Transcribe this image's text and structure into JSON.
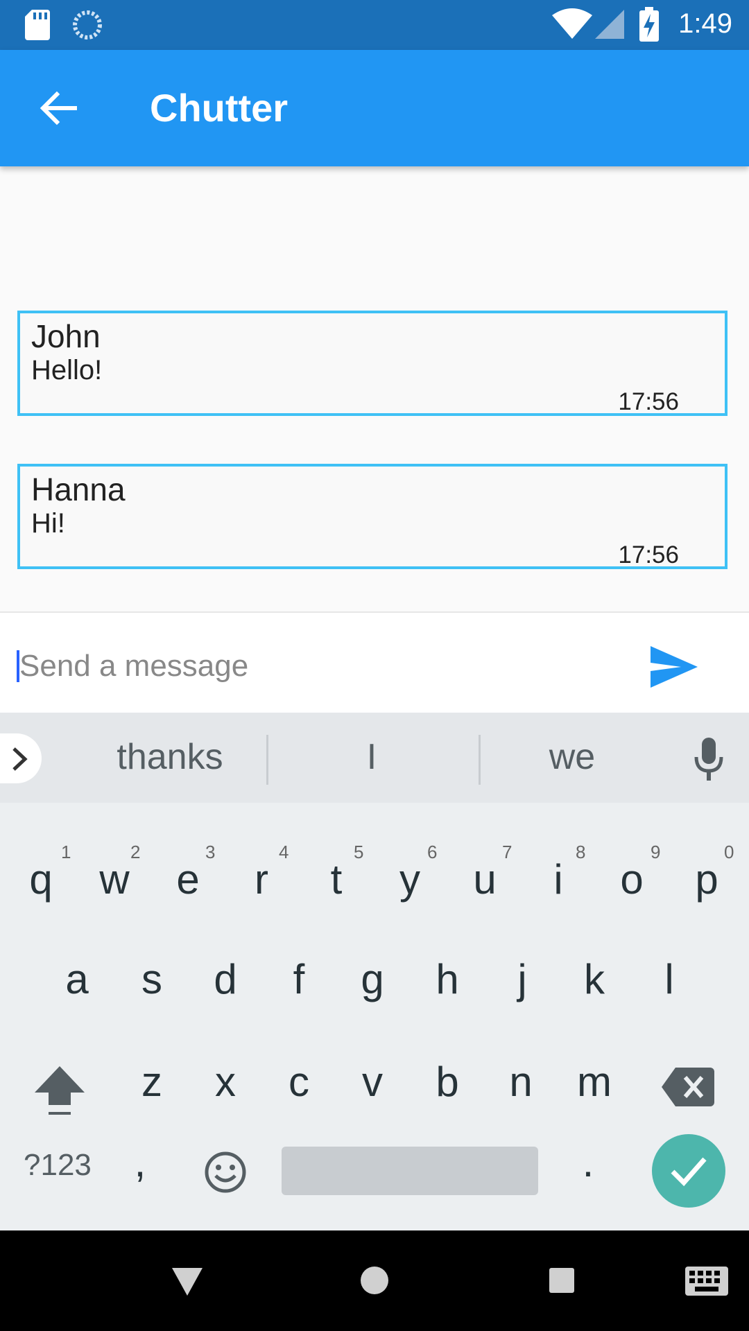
{
  "status_bar": {
    "time": "1:49"
  },
  "app_bar": {
    "title": "Chutter"
  },
  "messages": [
    {
      "sender": "John",
      "text": "Hello!",
      "time": "17:56"
    },
    {
      "sender": "Hanna",
      "text": "Hi!",
      "time": "17:56"
    }
  ],
  "composer": {
    "placeholder": "Send a message"
  },
  "keyboard": {
    "suggestions": [
      "thanks",
      "I",
      "we"
    ],
    "row1": [
      "q",
      "w",
      "e",
      "r",
      "t",
      "y",
      "u",
      "i",
      "o",
      "p"
    ],
    "row1_hints": [
      "1",
      "2",
      "3",
      "4",
      "5",
      "6",
      "7",
      "8",
      "9",
      "0"
    ],
    "row2": [
      "a",
      "s",
      "d",
      "f",
      "g",
      "h",
      "j",
      "k",
      "l"
    ],
    "row3": [
      "z",
      "x",
      "c",
      "v",
      "b",
      "n",
      "m"
    ],
    "symbols_label": "?123",
    "comma": ",",
    "period": "."
  },
  "colors": {
    "status_bar": "#1b70b8",
    "app_bar": "#2196f3",
    "message_border": "#3fc1f5",
    "enter": "#4db6ac"
  },
  "icons": [
    "sd-card-icon",
    "sync-icon",
    "wifi-icon",
    "signal-icon",
    "battery-charging-icon",
    "back-arrow-icon",
    "send-icon",
    "microphone-icon",
    "shift-icon",
    "backspace-icon",
    "emoji-icon",
    "checkmark-icon",
    "nav-back-icon",
    "nav-home-icon",
    "nav-recents-icon",
    "keyboard-icon"
  ]
}
